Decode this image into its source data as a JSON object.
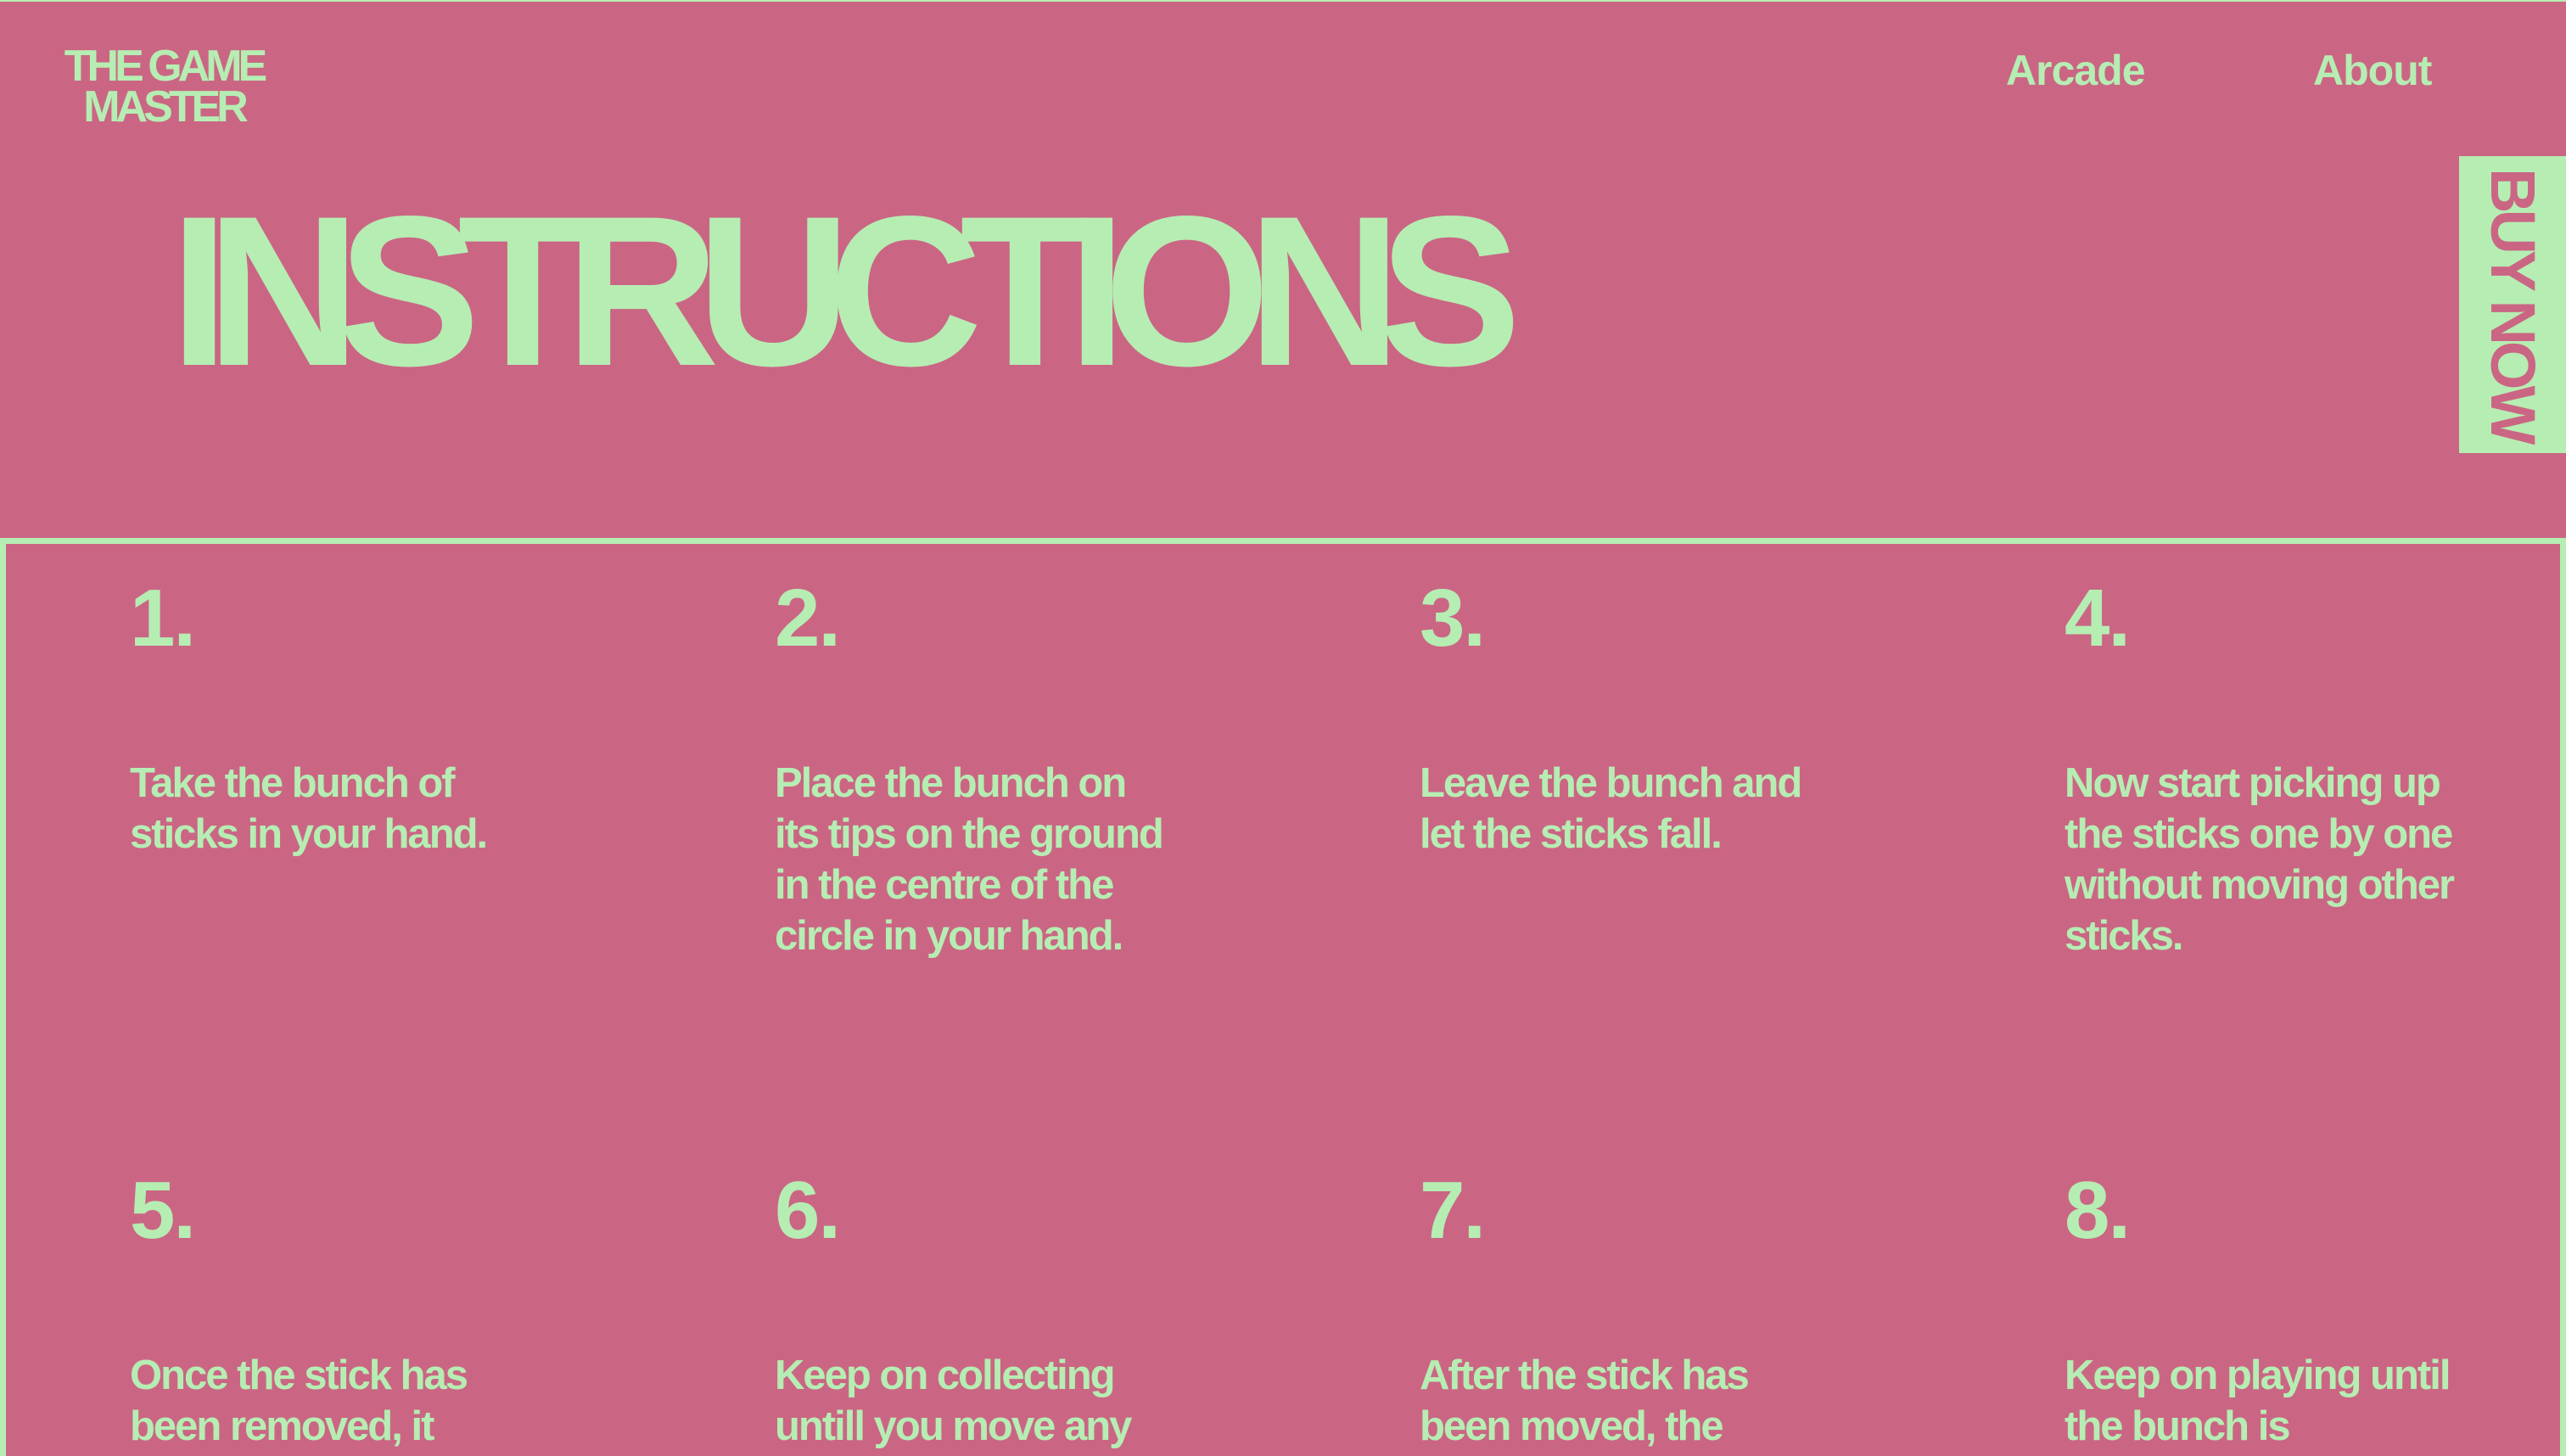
{
  "brand": {
    "line1": "THE GAME",
    "line2": "MASTER"
  },
  "nav": {
    "arcade": "Arcade",
    "about": "About"
  },
  "cta": {
    "buy_now": "BUY NOW"
  },
  "page": {
    "title": "INSTRUCTIONS"
  },
  "steps": [
    {
      "number": "1.",
      "text": "Take the bunch of sticks in your hand."
    },
    {
      "number": "2.",
      "text": "Place the bunch on its tips on the ground in the centre of the circle in your hand."
    },
    {
      "number": "3.",
      "text": "Leave the bunch and let the sticks fall."
    },
    {
      "number": "4.",
      "text": "Now start picking up the sticks one by one without moving other sticks."
    },
    {
      "number": "5.",
      "text": "Once the stick has been removed, it"
    },
    {
      "number": "6.",
      "text": "Keep on collecting untill you move any"
    },
    {
      "number": "7.",
      "text": "After the stick has been moved, the"
    },
    {
      "number": "8.",
      "text": "Keep on playing until the bunch is"
    }
  ],
  "colors": {
    "background": "#ca6684",
    "accent": "#b6edb3"
  }
}
